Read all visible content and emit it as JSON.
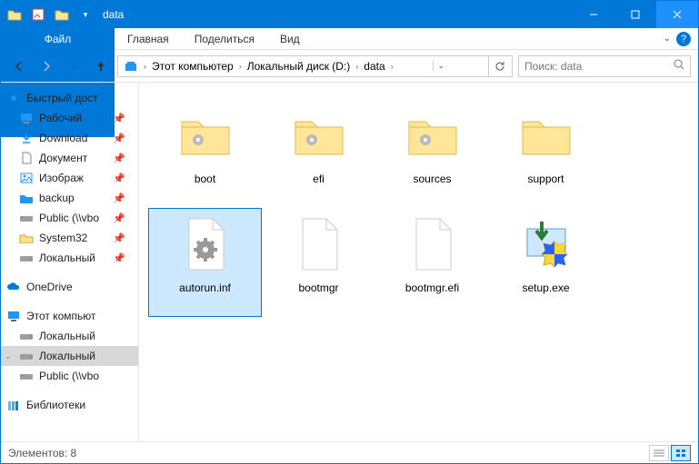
{
  "window": {
    "title": "data"
  },
  "ribbon": {
    "file": "Файл",
    "tabs": [
      "Главная",
      "Поделиться",
      "Вид"
    ]
  },
  "breadcrumb": {
    "segments": [
      "Этот компьютер",
      "Локальный диск (D:)",
      "data"
    ]
  },
  "search": {
    "placeholder": "Поиск: data"
  },
  "sidebar": {
    "quick_access": {
      "label": "Быстрый дост"
    },
    "items_pinned": [
      {
        "label": "Рабочий",
        "icon": "desktop"
      },
      {
        "label": "Download",
        "icon": "downloads"
      },
      {
        "label": "Документ",
        "icon": "documents"
      },
      {
        "label": "Изображ",
        "icon": "pictures"
      },
      {
        "label": "backup",
        "icon": "folder-blue"
      },
      {
        "label": "Public (\\\\vbo",
        "icon": "netdrive"
      },
      {
        "label": "System32",
        "icon": "folder"
      },
      {
        "label": "Локальный",
        "icon": "drive"
      }
    ],
    "onedrive": {
      "label": "OneDrive"
    },
    "thispc": {
      "label": "Этот компьют"
    },
    "drives": [
      {
        "label": "Локальный",
        "icon": "drive"
      },
      {
        "label": "Локальный",
        "icon": "drive",
        "selected": true
      },
      {
        "label": "Public (\\\\vbo",
        "icon": "netdrive"
      }
    ],
    "libraries": {
      "label": "Библиотеки"
    }
  },
  "files": [
    {
      "name": "boot",
      "type": "folder-config"
    },
    {
      "name": "efi",
      "type": "folder-config"
    },
    {
      "name": "sources",
      "type": "folder-config"
    },
    {
      "name": "support",
      "type": "folder"
    },
    {
      "name": "autorun.inf",
      "type": "inf",
      "selected": true
    },
    {
      "name": "bootmgr",
      "type": "blank"
    },
    {
      "name": "bootmgr.efi",
      "type": "blank"
    },
    {
      "name": "setup.exe",
      "type": "setup"
    }
  ],
  "status": {
    "count_label": "Элементов: 8"
  }
}
